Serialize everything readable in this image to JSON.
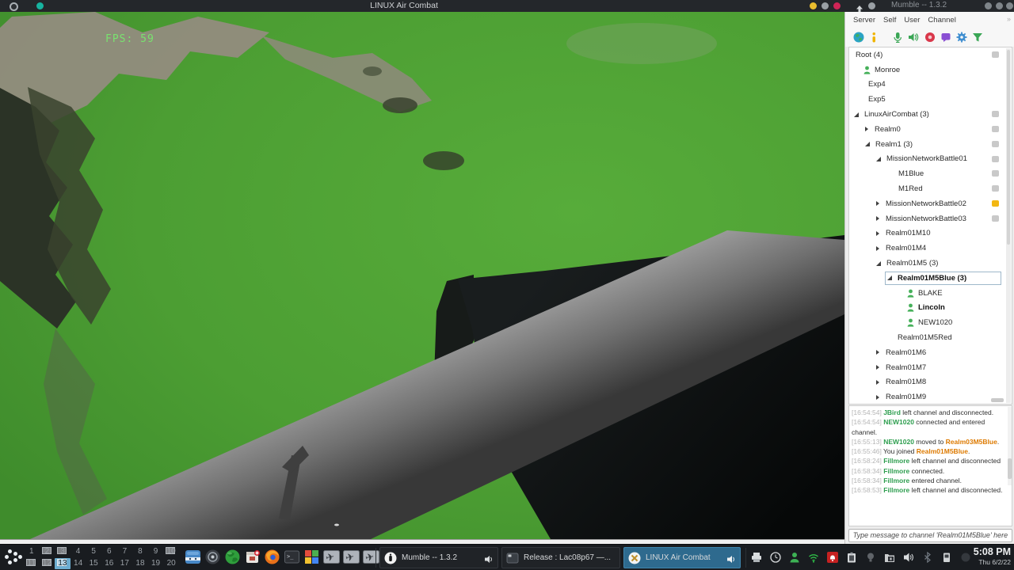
{
  "titlebar": {
    "game_title": "LINUX Air Combat",
    "mumble_title": "Mumble -- 1.3.2"
  },
  "game": {
    "fps": "FPS: 59"
  },
  "mumble": {
    "menu": [
      "Server",
      "Self",
      "User",
      "Channel"
    ],
    "menu_overflow": "»",
    "toolbar_icons": [
      "server-globe",
      "information",
      "microphone",
      "speaker",
      "record",
      "comment",
      "settings",
      "filter"
    ],
    "tree": [
      {
        "label": "Root (4)",
        "indent": 6,
        "comment": "gray"
      },
      {
        "label": "Monroe",
        "indent": 18,
        "user": true
      },
      {
        "label": "Exp4",
        "indent": 22
      },
      {
        "label": "Exp5",
        "indent": 22
      },
      {
        "label": "LinuxAirCombat (3)",
        "indent": 6,
        "arrow": "exp",
        "comment": "gray"
      },
      {
        "label": "Realm0",
        "indent": 20,
        "arrow": "col",
        "comment": "gray"
      },
      {
        "label": "Realm1 (3)",
        "indent": 20,
        "arrow": "exp",
        "comment": "gray"
      },
      {
        "label": "MissionNetworkBattle01",
        "indent": 34,
        "arrow": "exp",
        "comment": "gray"
      },
      {
        "label": "M1Blue",
        "indent": 60,
        "comment": "gray"
      },
      {
        "label": "M1Red",
        "indent": 60,
        "comment": "gray"
      },
      {
        "label": "MissionNetworkBattle02",
        "indent": 34,
        "arrow": "col",
        "comment": "yellow"
      },
      {
        "label": "MissionNetworkBattle03",
        "indent": 34,
        "arrow": "col",
        "comment": "gray"
      },
      {
        "label": "Realm01M10",
        "indent": 34,
        "arrow": "col"
      },
      {
        "label": "Realm01M4",
        "indent": 34,
        "arrow": "col"
      },
      {
        "label": "Realm01M5 (3)",
        "indent": 34,
        "arrow": "exp"
      },
      {
        "label": "Realm01M5Blue (3)",
        "indent": 48,
        "arrow": "exp",
        "bold": true,
        "selected": true
      },
      {
        "label": "BLAKE",
        "indent": 73,
        "user": true
      },
      {
        "label": "Lincoln",
        "indent": 73,
        "user": true,
        "bold": true
      },
      {
        "label": "NEW1020",
        "indent": 73,
        "user": true
      },
      {
        "label": "Realm01M5Red",
        "indent": 59
      },
      {
        "label": "Realm01M6",
        "indent": 34,
        "arrow": "col"
      },
      {
        "label": "Realm01M7",
        "indent": 34,
        "arrow": "col"
      },
      {
        "label": "Realm01M8",
        "indent": 34,
        "arrow": "col"
      },
      {
        "label": "Realm01M9",
        "indent": 34,
        "arrow": "col"
      }
    ],
    "chat": [
      [
        {
          "t": "[16:54:54]",
          "c": "time"
        },
        {
          "t": " ",
          "c": "plain"
        },
        {
          "t": "JBird",
          "c": "name"
        },
        {
          "t": " left channel and disconnected.",
          "c": "plain"
        }
      ],
      [
        {
          "t": "[16:54:54]",
          "c": "time"
        },
        {
          "t": " ",
          "c": "plain"
        },
        {
          "t": "NEW1020",
          "c": "name"
        },
        {
          "t": " connected and entered channel.",
          "c": "plain"
        }
      ],
      [
        {
          "t": "[16:55:13]",
          "c": "time"
        },
        {
          "t": " ",
          "c": "plain"
        },
        {
          "t": "NEW1020",
          "c": "name"
        },
        {
          "t": " moved to ",
          "c": "plain"
        },
        {
          "t": "Realm03M5Blue",
          "c": "channel"
        },
        {
          "t": ".",
          "c": "plain"
        }
      ],
      [
        {
          "t": "[16:55:46]",
          "c": "time"
        },
        {
          "t": " You joined ",
          "c": "plain"
        },
        {
          "t": "Realm01M5Blue",
          "c": "channel"
        },
        {
          "t": ".",
          "c": "plain"
        }
      ],
      [
        {
          "t": "[16:58:24]",
          "c": "time"
        },
        {
          "t": " ",
          "c": "plain"
        },
        {
          "t": "Fillmore",
          "c": "name"
        },
        {
          "t": " left channel and disconnected",
          "c": "plain"
        }
      ],
      [
        {
          "t": "[16:58:34]",
          "c": "time"
        },
        {
          "t": " ",
          "c": "plain"
        },
        {
          "t": "Fillmore",
          "c": "name"
        },
        {
          "t": " connected.",
          "c": "plain"
        }
      ],
      [
        {
          "t": "[16:58:34]",
          "c": "time"
        },
        {
          "t": " ",
          "c": "plain"
        },
        {
          "t": "Fillmore",
          "c": "name"
        },
        {
          "t": " entered channel.",
          "c": "plain"
        }
      ],
      [
        {
          "t": "[16:58:53]",
          "c": "time"
        },
        {
          "t": " ",
          "c": "plain"
        },
        {
          "t": "Fillmore",
          "c": "name"
        },
        {
          "t": " left channel and disconnected.",
          "c": "plain"
        }
      ]
    ],
    "input_placeholder": "Type message to channel 'Realm01M5Blue' here"
  },
  "taskbar": {
    "pager": {
      "count": 20,
      "cols": 10,
      "active": 13,
      "window_cells": [
        2,
        3,
        10,
        11,
        12
      ]
    },
    "launchers": [
      "file-manager",
      "disc-app",
      "globe-app",
      "package-manager",
      "firefox",
      "terminal",
      "four-color-app",
      "aircraft-1",
      "aircraft-2",
      "aircraft-3"
    ],
    "windows": [
      {
        "label": "Mumble -- 1.3.2",
        "icon": "mumble",
        "speaker": true,
        "active": false
      },
      {
        "label": "Release : Lac08p67 —...",
        "icon": "terminal",
        "speaker": false,
        "active": false
      },
      {
        "label": "LINUX Air Combat",
        "icon": "lac",
        "speaker": true,
        "active": true
      }
    ],
    "tray": [
      "printer",
      "clock",
      "mumble-user",
      "wifi",
      "alarm",
      "clipboard",
      "bulb",
      "folder-lock",
      "volume",
      "bluetooth",
      "device",
      "dim"
    ],
    "clock": {
      "time": "5:08 PM",
      "date": "Thu 6/2/22"
    }
  },
  "colors": {
    "fps_green": "#79e36f",
    "chat_name_green": "#2e9e4f",
    "chat_channel_orange": "#dd7a00",
    "active_task_blue": "#2e6a8e",
    "pager_active_blue": "#6cadd0",
    "comment_yellow": "#f2b713"
  }
}
